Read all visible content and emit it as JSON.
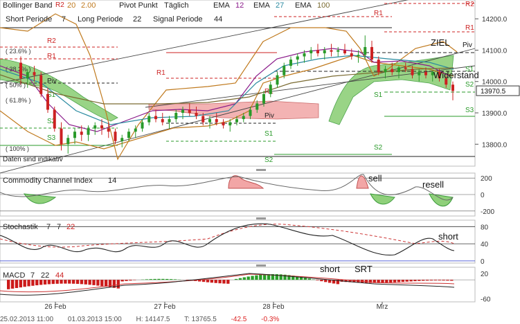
{
  "legend": {
    "bollinger": {
      "label": "Bollinger Band",
      "p1": "20",
      "p2": "2.00",
      "color": "#c07a1e"
    },
    "pivot": {
      "label": "Pivot Punkt",
      "mode": "Täglich",
      "color": "#cc2222"
    },
    "ema1": {
      "label": "EMA",
      "val": "12",
      "color": "#8a1a8a"
    },
    "ema2": {
      "label": "EMA",
      "val": "27",
      "color": "#2a8aa0"
    },
    "ema3": {
      "label": "EMA",
      "val": "100",
      "color": "#7a6a30"
    },
    "kumo": {
      "short": "Short Periode",
      "short_val": "7",
      "long": "Long Periode",
      "long_val": "22",
      "signal": "Signal Periode",
      "signal_val": "44"
    }
  },
  "price_panel": {
    "ymin": 13730,
    "ymax": 14260,
    "ticks": [
      "14200.0",
      "14100.0",
      "14000.0",
      "13900.0",
      "13800.0"
    ],
    "tick_values": [
      14200,
      14100,
      14000,
      13900,
      13800
    ],
    "last_price": "13970.5",
    "last_value": 13970.5,
    "note": "Daten sind indikativ",
    "fib": [
      "23.6%",
      "38.2%",
      "50%",
      "61.8%",
      "100%"
    ],
    "annotations": {
      "ziel": "ZIEL",
      "widerstand": "Widerstand"
    },
    "pivot_labels": {
      "r2": "R2",
      "r1": "R1",
      "piv": "Piv",
      "s1": "S1",
      "s2": "S2",
      "s3": "S3"
    }
  },
  "cci_panel": {
    "label": "Commodity Channel Index",
    "period": "14",
    "ticks": [
      "200",
      "0",
      "-200"
    ],
    "annotations": {
      "sell": "sell",
      "resell": "resell"
    }
  },
  "stoch_panel": {
    "label": "Stochastik",
    "p1": "7",
    "p2": "7",
    "p3": "22",
    "ticks": [
      "80",
      "40",
      "0"
    ],
    "annotations": {
      "short": "short"
    }
  },
  "macd_panel": {
    "label": "MACD",
    "p1": "7",
    "p2": "22",
    "p3": "44",
    "ticks": [
      "20",
      "-60"
    ],
    "annotations": {
      "short": "short",
      "srt": "SRT"
    }
  },
  "x_axis": {
    "labels": [
      "26 Feb",
      "27 Feb",
      "28 Feb",
      "Mrz"
    ]
  },
  "footer": {
    "from": "25.02.2013 11:00",
    "to": "01.03.2013 15:00",
    "high": "H: 14147.5",
    "low": "T: 13765.5",
    "change": "-42.5",
    "change_pct": "-0.3%"
  },
  "chart_data": {
    "type": "line",
    "title": "",
    "categories": [
      "26 Feb",
      "27 Feb",
      "28 Feb",
      "Mrz"
    ],
    "y_range": [
      13730,
      14260
    ],
    "y_ticks": [
      14200,
      14100,
      14000,
      13900,
      13800
    ],
    "grid": false,
    "legend": "top-left",
    "series": [
      {
        "name": "Bollinger Band",
        "values": []
      },
      {
        "name": "EMA 12",
        "values": []
      },
      {
        "name": "EMA 27",
        "values": []
      },
      {
        "name": "EMA 100",
        "values": []
      }
    ],
    "ohlc": [
      [
        14060,
        14080,
        13990,
        14010
      ],
      [
        14010,
        14040,
        13980,
        14030
      ],
      [
        14030,
        14050,
        14000,
        14020
      ],
      [
        14020,
        14030,
        13950,
        13960
      ],
      [
        13960,
        13980,
        13900,
        13910
      ],
      [
        13910,
        13920,
        13840,
        13850
      ],
      [
        13850,
        13870,
        13780,
        13800
      ],
      [
        13800,
        13830,
        13770,
        13820
      ],
      [
        13820,
        13850,
        13800,
        13840
      ],
      [
        13840,
        13860,
        13810,
        13830
      ],
      [
        13830,
        13860,
        13810,
        13850
      ],
      [
        13850,
        13870,
        13830,
        13860
      ],
      [
        13860,
        13880,
        13830,
        13850
      ],
      [
        13850,
        13870,
        13820,
        13840
      ],
      [
        13840,
        13850,
        13800,
        13810
      ],
      [
        13810,
        13830,
        13790,
        13820
      ],
      [
        13820,
        13850,
        13810,
        13840
      ],
      [
        13840,
        13860,
        13820,
        13850
      ],
      [
        13850,
        13880,
        13840,
        13870
      ],
      [
        13870,
        13900,
        13860,
        13890
      ],
      [
        13890,
        13910,
        13870,
        13880
      ],
      [
        13880,
        13900,
        13860,
        13870
      ],
      [
        13870,
        13890,
        13850,
        13880
      ],
      [
        13880,
        13910,
        13870,
        13900
      ],
      [
        13900,
        13920,
        13880,
        13910
      ],
      [
        13910,
        13930,
        13890,
        13900
      ],
      [
        13900,
        13920,
        13880,
        13890
      ],
      [
        13890,
        13900,
        13860,
        13870
      ],
      [
        13870,
        13890,
        13850,
        13880
      ],
      [
        13880,
        13900,
        13860,
        13870
      ],
      [
        13870,
        13880,
        13850,
        13860
      ],
      [
        13860,
        13880,
        13840,
        13870
      ],
      [
        13870,
        13890,
        13860,
        13880
      ],
      [
        13880,
        13900,
        13870,
        13890
      ],
      [
        13890,
        13920,
        13880,
        13910
      ],
      [
        13910,
        13940,
        13900,
        13930
      ],
      [
        13930,
        13970,
        13920,
        13960
      ],
      [
        13960,
        14000,
        13950,
        13990
      ],
      [
        13990,
        14030,
        13980,
        14020
      ],
      [
        14020,
        14060,
        14010,
        14050
      ],
      [
        14050,
        14080,
        14040,
        14070
      ],
      [
        14070,
        14090,
        14050,
        14080
      ],
      [
        14080,
        14100,
        14060,
        14090
      ],
      [
        14090,
        14110,
        14070,
        14100
      ],
      [
        14100,
        14120,
        14080,
        14090
      ],
      [
        14090,
        14110,
        14070,
        14100
      ],
      [
        14100,
        14120,
        14080,
        14095
      ],
      [
        14095,
        14110,
        14080,
        14100
      ],
      [
        14100,
        14120,
        14085,
        14090
      ],
      [
        14090,
        14105,
        14070,
        14080
      ],
      [
        14080,
        14100,
        14060,
        14085
      ],
      [
        14085,
        14147,
        14070,
        14110
      ],
      [
        14110,
        14130,
        14060,
        14070
      ],
      [
        14070,
        14080,
        14020,
        14030
      ],
      [
        14030,
        14050,
        14010,
        14040
      ],
      [
        14040,
        14060,
        14020,
        14030
      ],
      [
        14030,
        14050,
        14010,
        14045
      ],
      [
        14045,
        14060,
        14030,
        14040
      ],
      [
        14040,
        14050,
        14010,
        14020
      ],
      [
        14020,
        14040,
        14000,
        14030
      ],
      [
        14030,
        14045,
        14010,
        14020
      ],
      [
        14020,
        14035,
        14000,
        14030
      ],
      [
        14030,
        14040,
        14000,
        14010
      ],
      [
        14010,
        14020,
        13980,
        13990
      ],
      [
        13990,
        14000,
        13940,
        13970
      ]
    ]
  }
}
